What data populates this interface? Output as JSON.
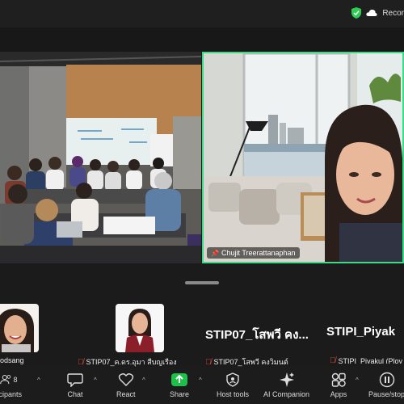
{
  "topbar": {
    "record_label": "Recor"
  },
  "video": {
    "right_tile_name": "Chujit Treerattanaphan"
  },
  "participants": [
    {
      "label": "odsang",
      "muted": false
    },
    {
      "label": "STIP07_ค.ดร.อุมา สืบญเรือง",
      "muted": true
    },
    {
      "big_name": "STIP07_โสพวี คง...",
      "label": "STIP07_โสพวี คงวิมนต์",
      "muted": true
    },
    {
      "big_name": "STIPI_Piyak",
      "label": "STIPI_Piyakul (Ploy",
      "muted": true
    }
  ],
  "toolbar": {
    "participants_count": "8",
    "items": [
      {
        "label": "ticipants",
        "icon": "participants-icon"
      },
      {
        "label": "Chat",
        "icon": "chat-icon"
      },
      {
        "label": "React",
        "icon": "heart-icon"
      },
      {
        "label": "Share",
        "icon": "share-icon"
      },
      {
        "label": "Host tools",
        "icon": "shield-icon"
      },
      {
        "label": "AI Companion",
        "icon": "sparkle-icon"
      },
      {
        "label": "Apps",
        "icon": "apps-icon"
      },
      {
        "label": "Pause/stop",
        "icon": "pause-icon"
      }
    ]
  },
  "colors": {
    "active_border": "#3ddc84",
    "share_green": "#1fbf4a",
    "muted_red": "#e2423a"
  }
}
